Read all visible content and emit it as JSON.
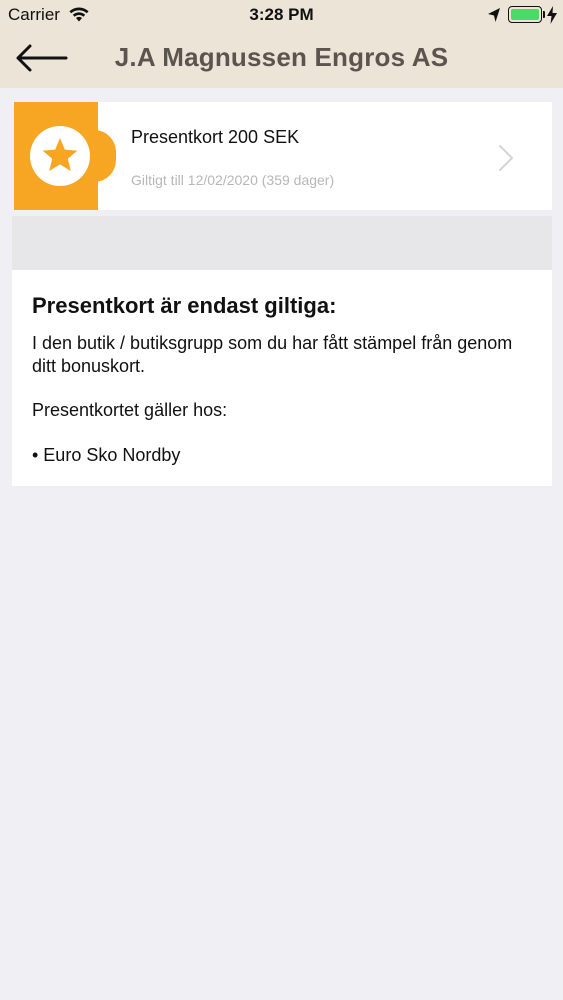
{
  "status_bar": {
    "carrier": "Carrier",
    "time": "3:28 PM",
    "battery_level": 1.0
  },
  "nav": {
    "title": "J.A Magnussen Engros AS"
  },
  "gift_card": {
    "name": "Presentkort 200 SEK",
    "validity": "Giltigt till 12/02/2020 (359 dager)",
    "badge_color": "#f6a623",
    "badge_icon": "star-icon"
  },
  "info": {
    "heading": "Presentkort är endast giltiga:",
    "description": "I den butik / butiksgrupp som du har fått stämpel från genom ditt bonuskort.",
    "valid_at_label": "Presentkortet gäller hos:",
    "stores": [
      "• Euro Sko Nordby"
    ]
  },
  "colors": {
    "header_bg": "#ebe4d7",
    "title_text": "#5c554f",
    "page_bg": "#efeff4",
    "accent": "#f6a623"
  }
}
